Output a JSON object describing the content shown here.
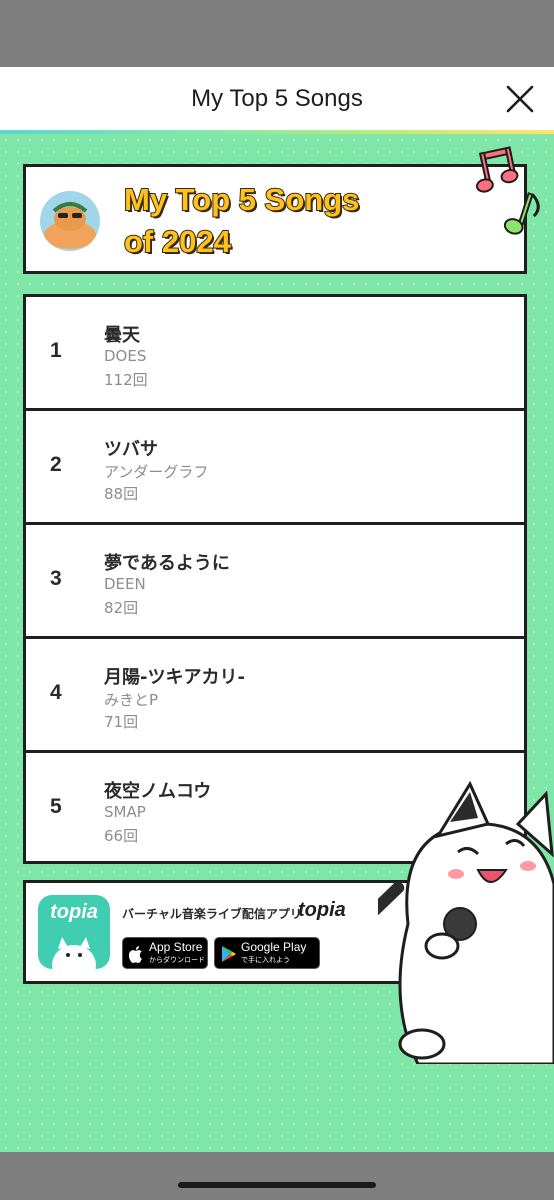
{
  "header": {
    "title": "My Top 5 Songs",
    "close_icon": "close-icon"
  },
  "card": {
    "title_line1": "My Top 5 Songs",
    "title_line2": "of 2024",
    "title_color": "#ffc21a"
  },
  "songs": [
    {
      "rank": "1",
      "title": "曇天",
      "artist": "DOES",
      "count": "112回"
    },
    {
      "rank": "2",
      "title": "ツバサ",
      "artist": "アンダーグラフ",
      "count": "88回"
    },
    {
      "rank": "3",
      "title": "夢であるように",
      "artist": "DEEN",
      "count": "82回"
    },
    {
      "rank": "4",
      "title": "月陽-ツキアカリ-",
      "artist": "みきとP",
      "count": "71回"
    },
    {
      "rank": "5",
      "title": "夜空ノムコウ",
      "artist": "SMAP",
      "count": "66回"
    }
  ],
  "promo": {
    "app_icon_text": "topia",
    "tagline": "バーチャル音楽ライブ配信アプリ",
    "brand": "topia",
    "app_store": {
      "small": "からダウンロード",
      "big": "App Store"
    },
    "google_play": {
      "small": "で手に入れよう",
      "big": "Google Play"
    }
  },
  "colors": {
    "background_green": "#7fe6a7",
    "accent_teal": "#41cdb1"
  }
}
